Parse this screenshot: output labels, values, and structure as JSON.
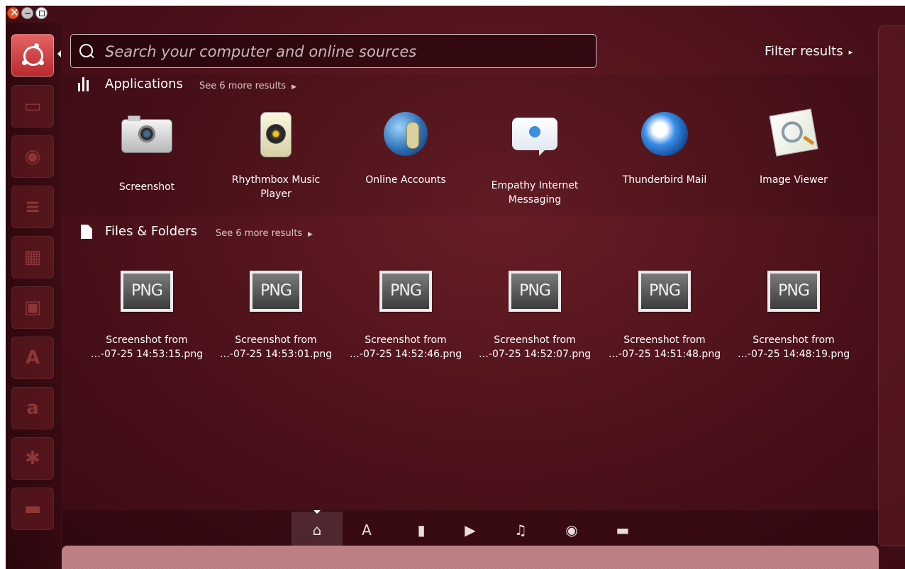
{
  "search": {
    "placeholder": "Search your computer and online sources"
  },
  "filter": {
    "label": "Filter results",
    "arrow": "▸"
  },
  "launcher": {
    "items": [
      {
        "name": "ubuntu-dash-button",
        "icon": "ubuntu-logo-icon"
      },
      {
        "name": "launcher-files",
        "icon": "file-cabinet-icon",
        "glyph": "▭"
      },
      {
        "name": "launcher-firefox",
        "icon": "firefox-icon",
        "glyph": "◉"
      },
      {
        "name": "launcher-writer",
        "icon": "libreoffice-writer-icon",
        "glyph": "≡"
      },
      {
        "name": "launcher-calc",
        "icon": "libreoffice-calc-icon",
        "glyph": "▦"
      },
      {
        "name": "launcher-impress",
        "icon": "libreoffice-impress-icon",
        "glyph": "▣"
      },
      {
        "name": "launcher-software-center",
        "icon": "software-center-icon",
        "glyph": "A"
      },
      {
        "name": "launcher-amazon",
        "icon": "amazon-icon",
        "glyph": "a"
      },
      {
        "name": "launcher-system-settings",
        "icon": "settings-gear-icon",
        "glyph": "✱"
      },
      {
        "name": "launcher-drive",
        "icon": "drive-icon",
        "glyph": "▬"
      }
    ]
  },
  "applications": {
    "title": "Applications",
    "more": "See 6 more results",
    "items": [
      {
        "label": "Screenshot",
        "icon": "camera-icon"
      },
      {
        "label": "Rhythmbox Music Player",
        "icon": "speaker-icon"
      },
      {
        "label": "Online Accounts",
        "icon": "globe-keys-icon"
      },
      {
        "label": "Empathy Internet Messaging",
        "icon": "chat-bubble-icon"
      },
      {
        "label": "Thunderbird Mail",
        "icon": "thunderbird-icon"
      },
      {
        "label": "Image Viewer",
        "icon": "image-viewer-icon"
      }
    ]
  },
  "files": {
    "title": "Files & Folders",
    "more": "See 6 more results",
    "items": [
      {
        "line1": "Screenshot from",
        "line2": "…-07-25 14:53:15.png",
        "badge": "PNG"
      },
      {
        "line1": "Screenshot from",
        "line2": "…-07-25 14:53:01.png",
        "badge": "PNG"
      },
      {
        "line1": "Screenshot from",
        "line2": "…-07-25 14:52:46.png",
        "badge": "PNG"
      },
      {
        "line1": "Screenshot from",
        "line2": "…-07-25 14:52:07.png",
        "badge": "PNG"
      },
      {
        "line1": "Screenshot from",
        "line2": "…-07-25 14:51:48.png",
        "badge": "PNG"
      },
      {
        "line1": "Screenshot from",
        "line2": "…-07-25 14:48:19.png",
        "badge": "PNG"
      }
    ]
  },
  "lenses": [
    {
      "name": "home-lens",
      "glyph": "⌂",
      "active": true
    },
    {
      "name": "applications-lens",
      "glyph": "A"
    },
    {
      "name": "files-lens",
      "glyph": "▮"
    },
    {
      "name": "video-lens",
      "glyph": "▶"
    },
    {
      "name": "music-lens",
      "glyph": "♫"
    },
    {
      "name": "photo-lens",
      "glyph": "◉"
    },
    {
      "name": "social-lens",
      "glyph": "▬"
    }
  ],
  "colors": {
    "accent": "#e95420",
    "background": "#4a1019",
    "text": "#ffffff"
  }
}
